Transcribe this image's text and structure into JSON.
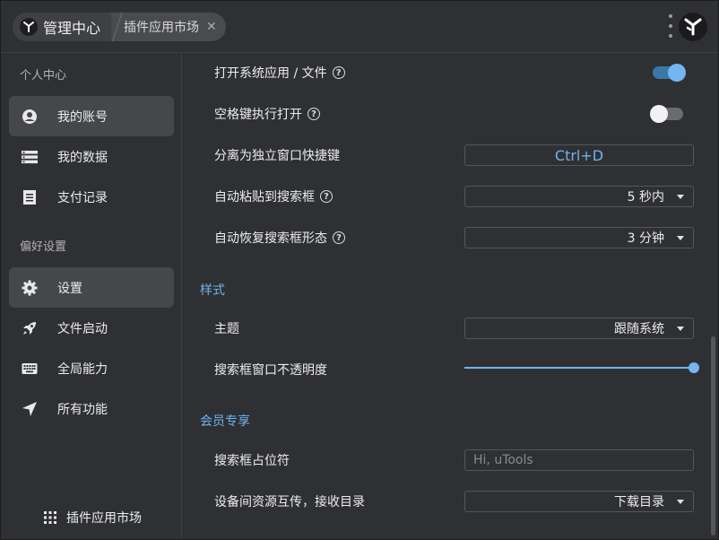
{
  "titlebar": {
    "main_tab_label": "管理中心",
    "plugin_tab_label": "插件应用市场",
    "close_glyph": "✕"
  },
  "sidebar": {
    "group_personal": "个人中心",
    "group_prefs": "偏好设置",
    "items": [
      {
        "label": "我的账号",
        "icon": "account-icon"
      },
      {
        "label": "我的数据",
        "icon": "data-icon"
      },
      {
        "label": "支付记录",
        "icon": "receipt-icon"
      },
      {
        "label": "设置",
        "icon": "gear-icon"
      },
      {
        "label": "文件启动",
        "icon": "rocket-icon"
      },
      {
        "label": "全局能力",
        "icon": "keyboard-icon"
      },
      {
        "label": "所有功能",
        "icon": "navigation-icon"
      }
    ],
    "bottom_label": "插件应用市场"
  },
  "settings": {
    "open_system_app": "打开系统应用 / 文件",
    "space_open": "空格键执行打开",
    "detach_hotkey_label": "分离为独立窗口快捷键",
    "detach_hotkey_value": "Ctrl+D",
    "auto_paste_label": "自动粘贴到搜索框",
    "auto_paste_value": "5 秒内",
    "auto_restore_label": "自动恢复搜索框形态",
    "auto_restore_value": "3 分钟",
    "style_section": "样式",
    "theme_label": "主题",
    "theme_value": "跟随系统",
    "opacity_label": "搜索框窗口不透明度",
    "opacity_level": 1.0,
    "member_section": "会员专享",
    "placeholder_label": "搜索框占位符",
    "placeholder_value": "Hi, uTools",
    "receive_dir_label": "设备间资源互传，接收目录",
    "receive_dir_value": "下载目录"
  },
  "toggles": {
    "open_system_app": true,
    "space_open": false
  },
  "help_glyph": "?",
  "colors": {
    "accent": "#6fb3f0",
    "background": "#2f3033",
    "active_item": "#46474a"
  }
}
